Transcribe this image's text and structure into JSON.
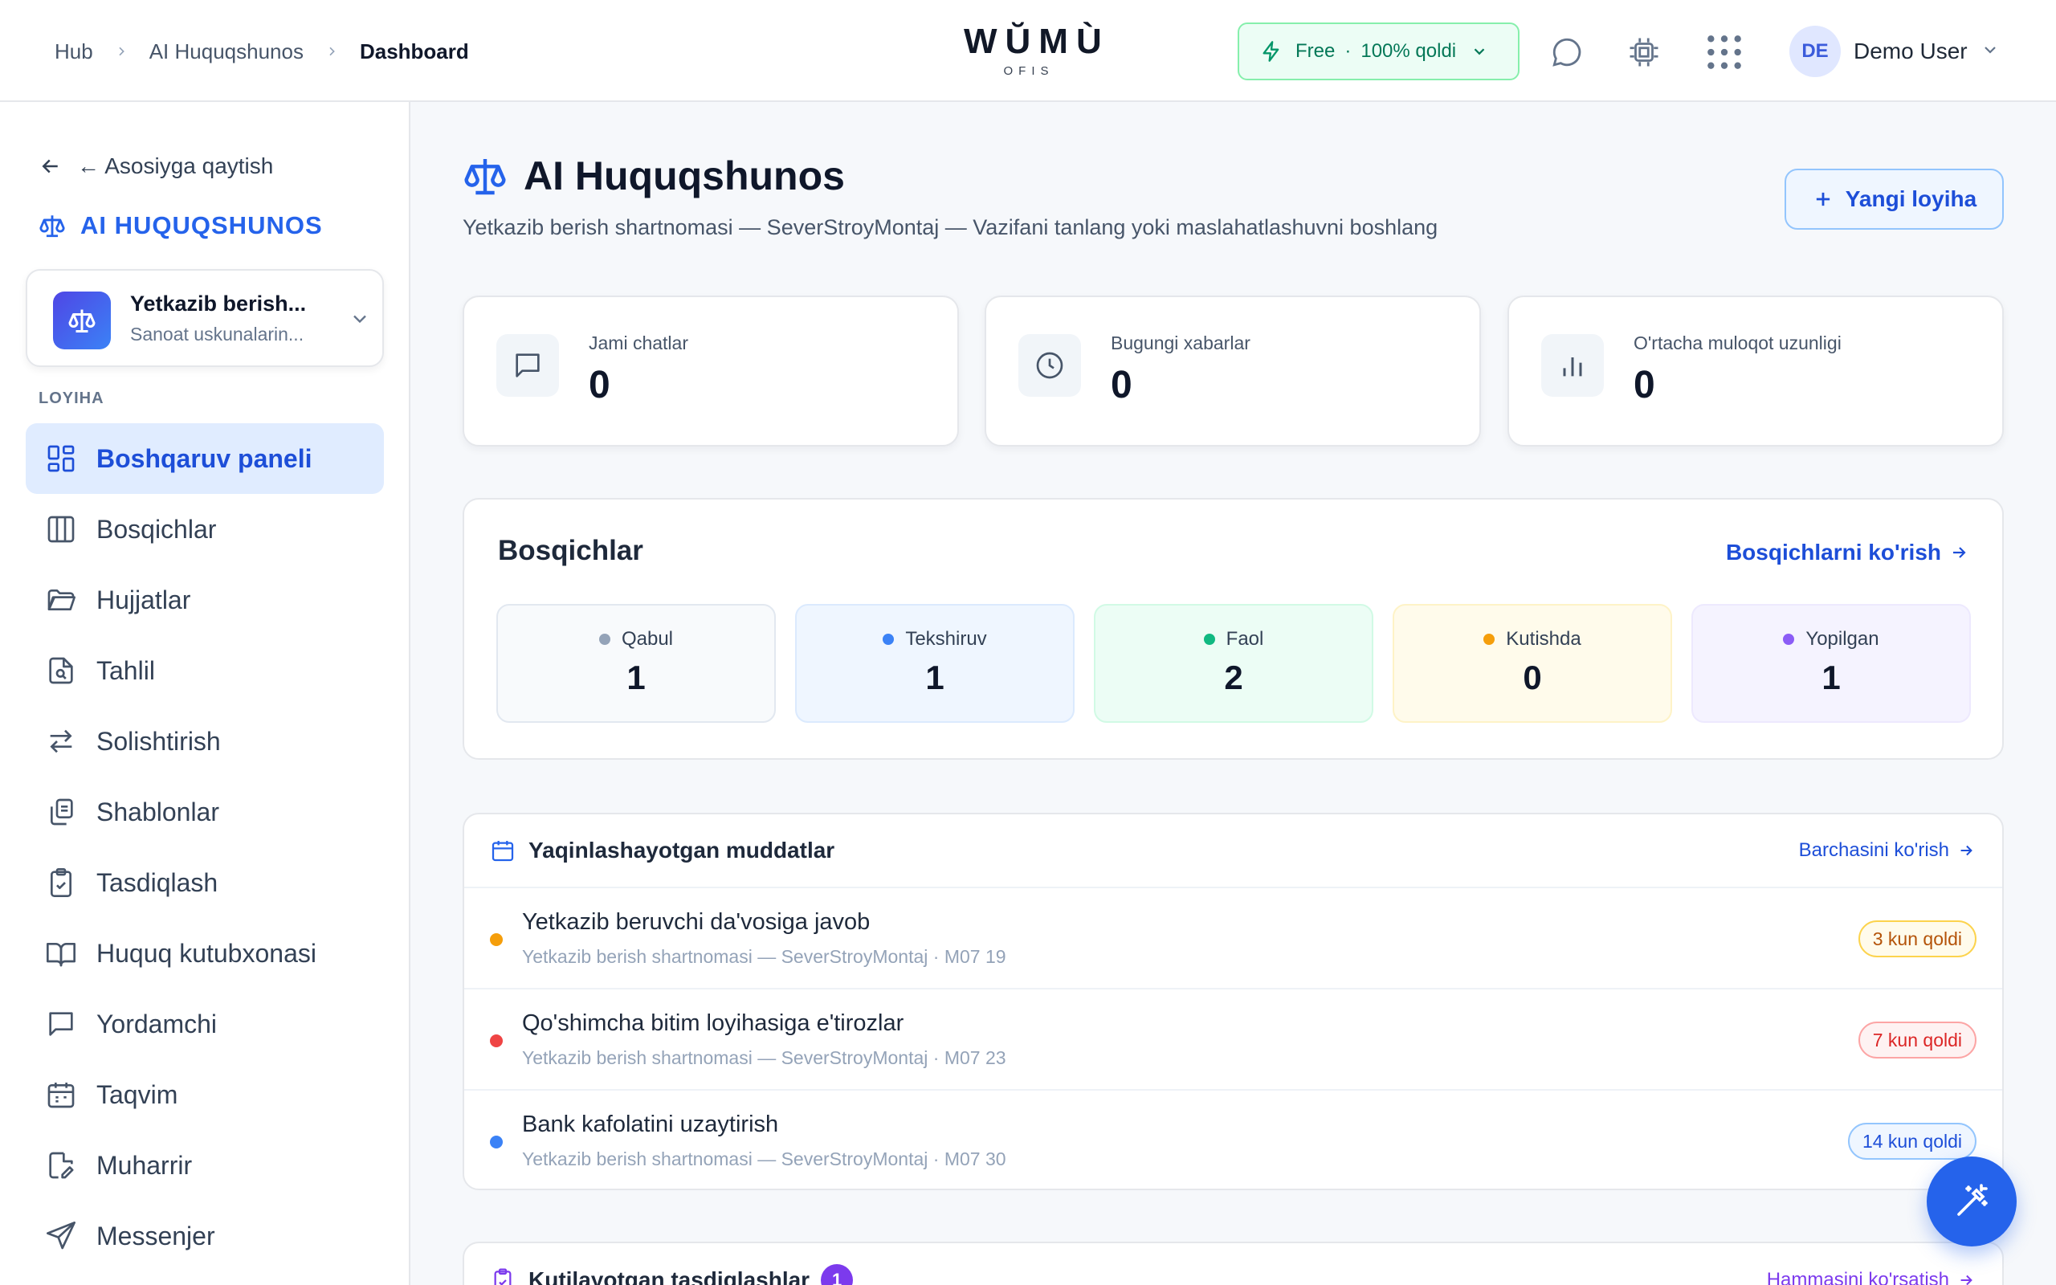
{
  "header": {
    "breadcrumbs": [
      "Hub",
      "AI Huquqshunos",
      "Dashboard"
    ],
    "logo": {
      "mark": "WŬMÙ",
      "sub": "OFIS"
    },
    "plan": {
      "name": "Free",
      "remaining": "100% qoldi"
    },
    "user": {
      "initials": "DE",
      "name": "Demo User"
    }
  },
  "sidebar": {
    "back_label": "← Asosiyga qaytish",
    "section_title": "AI HUQUQSHUNOS",
    "project": {
      "title": "Yetkazib berish...",
      "subtitle": "Sanoat uskunalarin..."
    },
    "group_label": "LOYIHA",
    "items": [
      {
        "label": "Boshqaruv paneli",
        "icon": "dashboard-icon",
        "active": true
      },
      {
        "label": "Bosqichlar",
        "icon": "columns-icon"
      },
      {
        "label": "Hujjatlar",
        "icon": "folder-icon"
      },
      {
        "label": "Tahlil",
        "icon": "file-search-icon"
      },
      {
        "label": "Solishtirish",
        "icon": "compare-arrows-icon"
      },
      {
        "label": "Shablonlar",
        "icon": "copy-icon"
      },
      {
        "label": "Tasdiqlash",
        "icon": "clipboard-check-icon"
      },
      {
        "label": "Huquq kutubxonasi",
        "icon": "book-icon"
      },
      {
        "label": "Yordamchi",
        "icon": "chat-icon"
      },
      {
        "label": "Taqvim",
        "icon": "calendar-icon"
      },
      {
        "label": "Muharrir",
        "icon": "file-edit-icon"
      },
      {
        "label": "Messenjer",
        "icon": "send-icon"
      }
    ]
  },
  "main": {
    "title": "AI Huquqshunos",
    "subtitle": "Yetkazib berish shartnomasi — SeverStroyMontaj — Vazifani tanlang yoki maslahatlashuvni boshlang",
    "new_button": "Yangi loyiha",
    "stats": [
      {
        "label": "Jami chatlar",
        "value": "0",
        "icon": "chat-icon"
      },
      {
        "label": "Bugungi xabarlar",
        "value": "0",
        "icon": "clock-icon"
      },
      {
        "label": "O'rtacha muloqot uzunligi",
        "value": "0",
        "icon": "bar-chart-icon"
      }
    ],
    "stages": {
      "title": "Bosqichlar",
      "link": "Bosqichlarni ko'rish",
      "items": [
        {
          "name": "Qabul",
          "count": "1",
          "color": "#94a3b8",
          "bg": "#f8fafc",
          "border": "#e2e8f0"
        },
        {
          "name": "Tekshiruv",
          "count": "1",
          "color": "#3b82f6",
          "bg": "#eff6ff",
          "border": "#dbeafe"
        },
        {
          "name": "Faol",
          "count": "2",
          "color": "#10b981",
          "bg": "#ecfdf5",
          "border": "#d1fae5"
        },
        {
          "name": "Kutishda",
          "count": "0",
          "color": "#f59e0b",
          "bg": "#fffbeb",
          "border": "#fef3c7"
        },
        {
          "name": "Yopilgan",
          "count": "1",
          "color": "#8b5cf6",
          "bg": "#f5f3ff",
          "border": "#ede9fe"
        }
      ]
    },
    "deadlines": {
      "title": "Yaqinlashayotgan muddatlar",
      "link": "Barchasini ko'rish",
      "items": [
        {
          "title": "Yetkazib beruvchi da'vosiga javob",
          "meta": "Yetkazib berish shartnomasi — SeverStroyMontaj · M07 19",
          "badge": "3 kun qoldi",
          "color": "#f59e0b",
          "badge_text": "#b45309",
          "badge_bg": "#fffbeb",
          "badge_border": "#fcd34d"
        },
        {
          "title": "Qo'shimcha bitim loyihasiga e'tirozlar",
          "meta": "Yetkazib berish shartnomasi — SeverStroyMontaj · M07 23",
          "badge": "7 kun qoldi",
          "color": "#ef4444",
          "badge_text": "#dc2626",
          "badge_bg": "#fef2f2",
          "badge_border": "#fca5a5"
        },
        {
          "title": "Bank kafolatini uzaytirish",
          "meta": "Yetkazib berish shartnomasi — SeverStroyMontaj · M07 30",
          "badge": "14 kun qoldi",
          "color": "#3b82f6",
          "badge_text": "#1d4ed8",
          "badge_bg": "#eff6ff",
          "badge_border": "#93c5fd"
        }
      ]
    },
    "approvals": {
      "title": "Kutilayotgan tasdiqlashlar",
      "count": "1",
      "link": "Hammasini ko'rsatish"
    }
  }
}
